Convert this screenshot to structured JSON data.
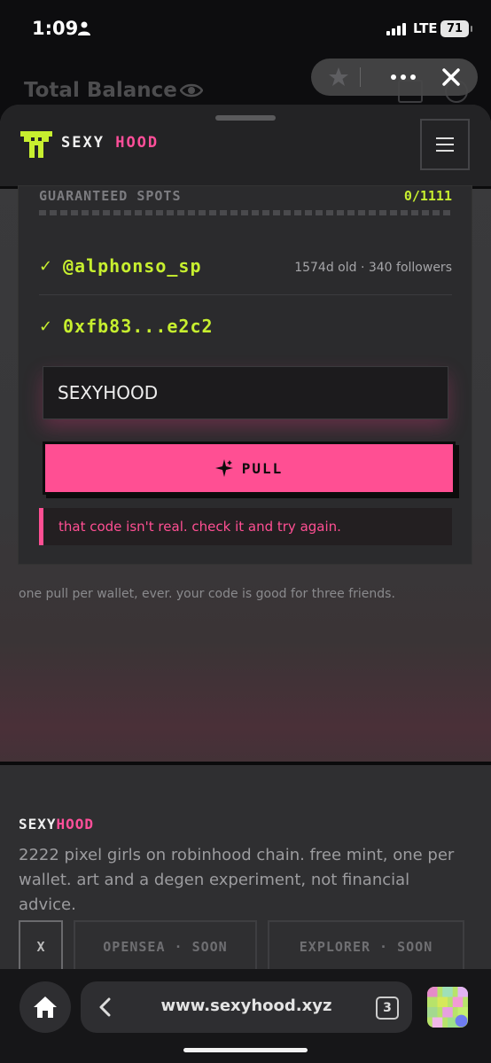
{
  "status_bar": {
    "time": "1:09",
    "network": "LTE",
    "battery": "71"
  },
  "background_page": {
    "title": "Total Balance"
  },
  "site": {
    "brand_part1": "SEXY",
    "brand_part2": "HOOD",
    "accent_pink": "#ff4f9a",
    "accent_green": "#c7ef2f"
  },
  "claim": {
    "spots_label": "GUARANTEED SPOTS",
    "spots_count": "0/1111",
    "twitter_handle": "@alphonso_sp",
    "twitter_meta": "1574d old · 340 followers",
    "wallet_address": "0xfb83...e2c2",
    "code_value": "SEXYHOOD",
    "pull_label": "PULL",
    "error_message": "that code isn't real. check it and try again.",
    "footnote": "one pull per wallet, ever. your code is good for three friends."
  },
  "footer": {
    "brand_part1": "SEXY",
    "brand_part2": "HOOD",
    "description": "2222 pixel girls on robinhood chain. free mint, one per wallet. art and a degen experiment, not financial advice.",
    "links": [
      "X",
      "OPENSEA · SOON",
      "EXPLORER · SOON"
    ]
  },
  "browser": {
    "url": "www.sexyhood.xyz",
    "tab_count": "3"
  }
}
